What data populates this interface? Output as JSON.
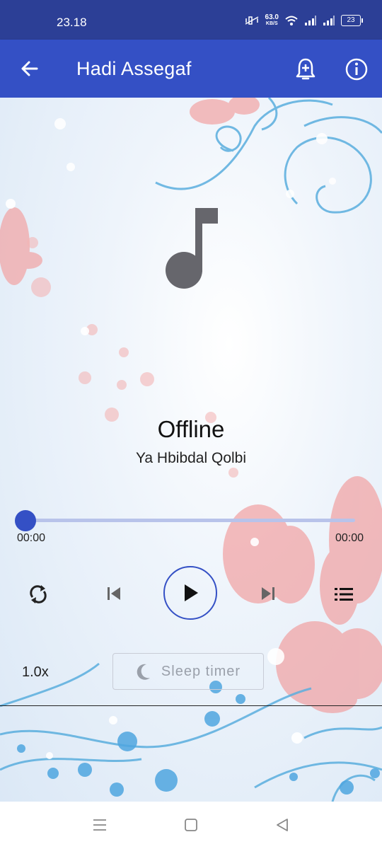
{
  "status_bar": {
    "time": "23.18",
    "net_speed_value": "63.0",
    "net_speed_unit": "KB/S",
    "battery": "23"
  },
  "app_bar": {
    "title": "Hadi Assegaf",
    "back_icon": "arrow-left-icon",
    "alarm_icon": "alarm-add-icon",
    "info_icon": "info-icon"
  },
  "player": {
    "artwork_icon": "music-note-icon",
    "title": "Offline",
    "subtitle": "Ya Hbibdal Qolbi",
    "progress_fraction": 0,
    "elapsed": "00:00",
    "duration": "00:00",
    "speed": "1.0x",
    "sleep_timer_label": "Sleep timer"
  },
  "colors": {
    "primary": "#3450c5",
    "status_bar": "#2c3f96",
    "progress_track": "#b8c3ea"
  }
}
